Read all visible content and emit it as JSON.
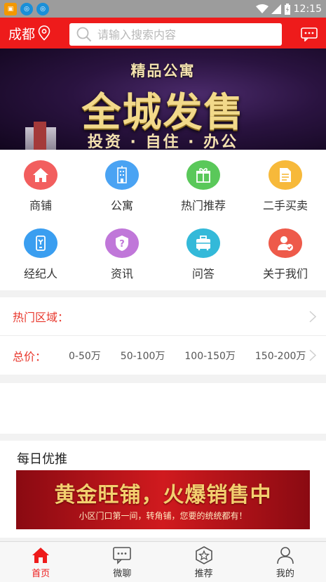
{
  "status_bar": {
    "time": "12:15"
  },
  "header": {
    "city": "成都",
    "search_placeholder": "请输入搜索内容"
  },
  "banner": {
    "subtitle": "精品公寓",
    "title": "全城发售",
    "tagline": "投资 · 自住 · 办公"
  },
  "categories": [
    {
      "label": "商铺",
      "icon": "house-icon",
      "color": "#f25e5e"
    },
    {
      "label": "公寓",
      "icon": "building-icon",
      "color": "#4aa3f3"
    },
    {
      "label": "热门推荐",
      "icon": "gift-icon",
      "color": "#5ac85a"
    },
    {
      "label": "二手买卖",
      "icon": "document-icon",
      "color": "#f7b93a"
    },
    {
      "label": "经纪人",
      "icon": "agent-icon",
      "color": "#3a9ef0"
    },
    {
      "label": "资讯",
      "icon": "question-icon",
      "color": "#c077d9"
    },
    {
      "label": "问答",
      "icon": "suitcase-icon",
      "color": "#33b9d9"
    },
    {
      "label": "关于我们",
      "icon": "user-badge-icon",
      "color": "#ee5a4a"
    }
  ],
  "filters": {
    "hot_area_label": "热门区域：",
    "price_label": "总价：",
    "price_options": [
      "0-50万",
      "50-100万",
      "100-150万",
      "150-200万"
    ]
  },
  "daily": {
    "title": "每日优推",
    "promo_title": "黄金旺铺，火爆销售中",
    "promo_subtitle": "小区门口第一间，转角铺，您要的统统都有！"
  },
  "tabs": [
    {
      "label": "首页",
      "icon": "home-icon",
      "active": true
    },
    {
      "label": "微聊",
      "icon": "chat-icon",
      "active": false
    },
    {
      "label": "推荐",
      "icon": "star-badge-icon",
      "active": false
    },
    {
      "label": "我的",
      "icon": "person-icon",
      "active": false
    }
  ],
  "colors": {
    "brand": "#ee1b1b",
    "accent_text": "#e8372c"
  }
}
